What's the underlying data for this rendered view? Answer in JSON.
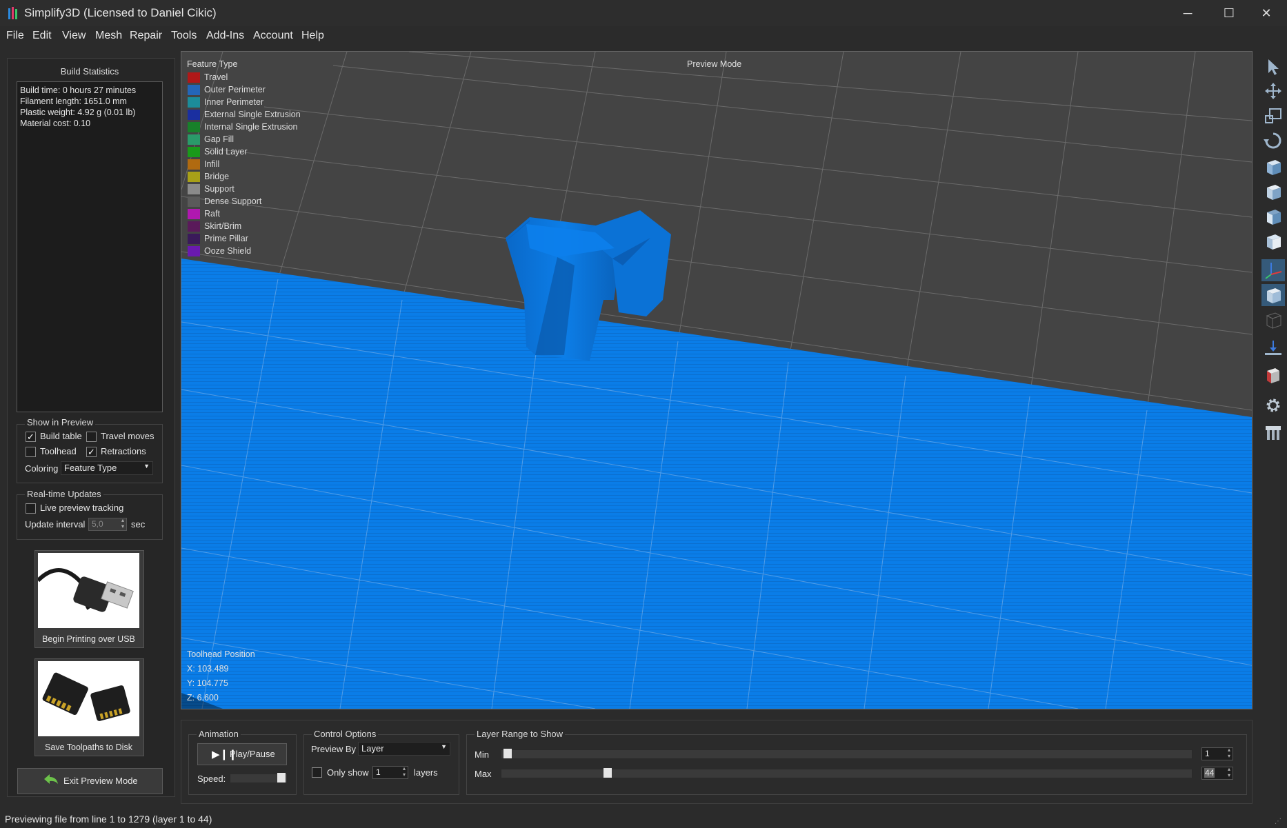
{
  "window": {
    "title": "Simplify3D (Licensed to Daniel Cikic)",
    "minimize_glyph": "─",
    "maximize_glyph": "☐",
    "close_glyph": "✕"
  },
  "menu": [
    "File",
    "Edit",
    "View",
    "Mesh",
    "Repair",
    "Tools",
    "Add-Ins",
    "Account",
    "Help"
  ],
  "build_statistics": {
    "title": "Build Statistics",
    "lines": [
      "Build time: 0 hours 27 minutes",
      "Filament length: 1651.0 mm",
      "Plastic weight: 4.92 g (0.01 lb)",
      "Material cost: 0.10"
    ]
  },
  "show_in_preview": {
    "title": "Show in Preview",
    "build_table": {
      "label": "Build table",
      "checked": true
    },
    "travel_moves": {
      "label": "Travel moves",
      "checked": false
    },
    "toolhead": {
      "label": "Toolhead",
      "checked": false
    },
    "retractions": {
      "label": "Retractions",
      "checked": true
    },
    "coloring_label": "Coloring",
    "coloring_value": "Feature Type"
  },
  "realtime": {
    "title": "Real-time Updates",
    "live_tracking": {
      "label": "Live preview tracking",
      "checked": false
    },
    "interval_label": "Update interval",
    "interval_value": "5,0",
    "interval_unit": "sec"
  },
  "actions": {
    "usb_label": "Begin Printing over USB",
    "disk_label": "Save Toolpaths to Disk",
    "exit_label": "Exit Preview Mode"
  },
  "viewport": {
    "legend_title": "Feature Type",
    "mode_label": "Preview Mode",
    "legend": [
      {
        "label": "Travel",
        "color": "#b01818"
      },
      {
        "label": "Outer Perimeter",
        "color": "#2466b8"
      },
      {
        "label": "Inner Perimeter",
        "color": "#1c8c9a"
      },
      {
        "label": "External Single Extrusion",
        "color": "#1a2fa0"
      },
      {
        "label": "Internal Single Extrusion",
        "color": "#18802a"
      },
      {
        "label": "Gap Fill",
        "color": "#2a9a6a"
      },
      {
        "label": "Solid Layer",
        "color": "#1a9a1a"
      },
      {
        "label": "Infill",
        "color": "#b06a10"
      },
      {
        "label": "Bridge",
        "color": "#a8a018"
      },
      {
        "label": "Support",
        "color": "#8a8a8a"
      },
      {
        "label": "Dense Support",
        "color": "#5a5a5a"
      },
      {
        "label": "Raft",
        "color": "#b018b0"
      },
      {
        "label": "Skirt/Brim",
        "color": "#5a1a5a"
      },
      {
        "label": "Prime Pillar",
        "color": "#3a1a5a"
      },
      {
        "label": "Ooze Shield",
        "color": "#6a1ab0"
      }
    ],
    "toolhead_title": "Toolhead Position",
    "x": "X: 103.489",
    "y": "Y: 104.775",
    "z": "Z: 6.600",
    "print_color": "#0a7de8"
  },
  "right_toolbar": [
    "select-icon",
    "move-icon",
    "scale-icon",
    "rotate-icon",
    "view-default-icon",
    "view-front-icon",
    "view-side-icon",
    "view-top-icon",
    "axes-icon",
    "solid-view-icon",
    "wireframe-icon",
    "flatten-icon",
    "cross-section-icon",
    "settings-gear-icon",
    "support-icon"
  ],
  "animation": {
    "title": "Animation",
    "play_label": "Play/Pause",
    "speed_label": "Speed:",
    "speed_level": 1.0
  },
  "control_options": {
    "title": "Control Options",
    "preview_by_label": "Preview By",
    "preview_by_value": "Layer",
    "only_show_label": "Only show",
    "only_show_value": "1",
    "layers_label": "layers"
  },
  "layer_range": {
    "title": "Layer Range to Show",
    "min_label": "Min",
    "max_label": "Max",
    "min_value": "1",
    "max_value": "44",
    "min_level": 0.0,
    "max_level": 0.15
  },
  "status": "Previewing file from line 1 to 1279 (layer 1 to 44)"
}
